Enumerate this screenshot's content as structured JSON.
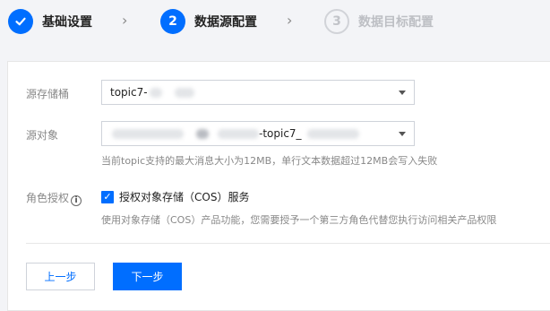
{
  "steps": [
    {
      "label": "基础设置",
      "number": "",
      "state": "done",
      "icon": "check-icon"
    },
    {
      "label": "数据源配置",
      "number": "2",
      "state": "active"
    },
    {
      "label": "数据目标配置",
      "number": "3",
      "state": "pending"
    }
  ],
  "step_separator_icon": "chevron-right-icon",
  "form": {
    "bucket": {
      "label": "源存储桶",
      "value": "topic7-"
    },
    "object": {
      "label": "源对象",
      "value": "-topic7_",
      "hint": "当前topic支持的最大消息大小为12MB，单行文本数据超过12MB会写入失败"
    },
    "role": {
      "label": "角色授权",
      "info_icon": "info-icon",
      "checkbox_label": "授权对象存储（COS）服务",
      "checked": true,
      "hint": "使用对象存储（COS）产品功能，您需要授予一个第三方角色代替您执行访问相关产品权限"
    }
  },
  "buttons": {
    "prev": "上一步",
    "next": "下一步"
  },
  "colors": {
    "primary": "#006eff",
    "background": "#f3f4f7",
    "pending": "#c2c4c9"
  }
}
